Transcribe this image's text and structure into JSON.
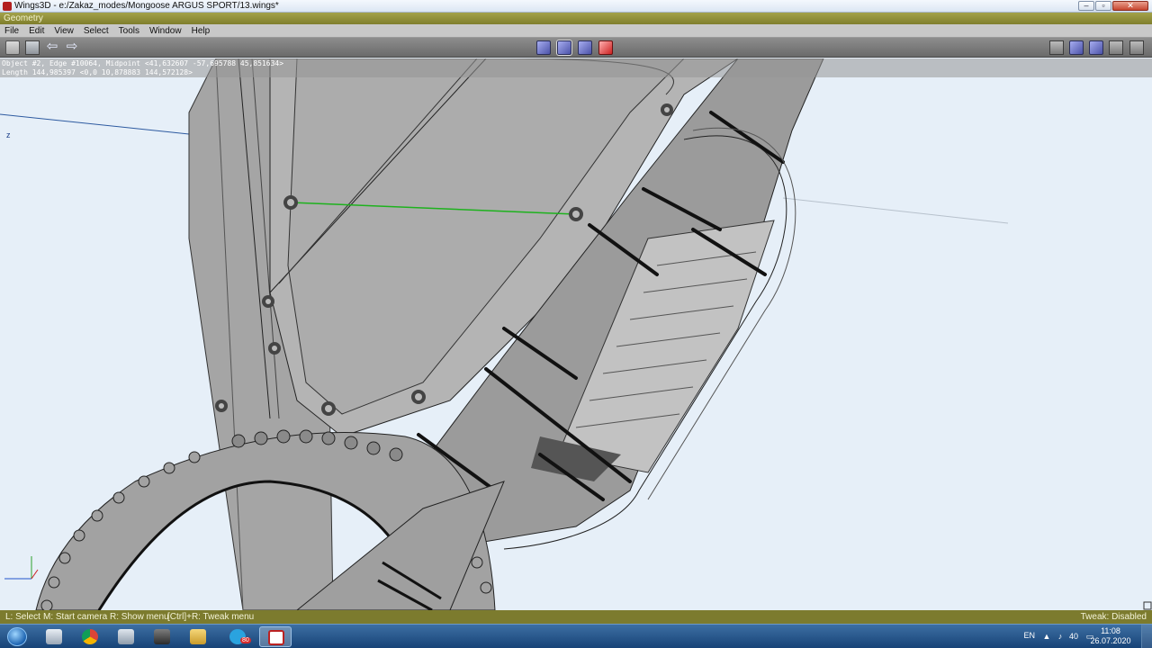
{
  "window": {
    "title": "Wings3D - e:/Zakaz_modes/Mongoose ARGUS SPORT/13.wings*",
    "controls": {
      "minimize": "–",
      "maximize": "▫",
      "close": "✕"
    }
  },
  "geometry_strip": {
    "label": "Geometry"
  },
  "menu": {
    "items": [
      "File",
      "Edit",
      "View",
      "Select",
      "Tools",
      "Window",
      "Help"
    ]
  },
  "toolbar": {
    "left_buttons": [
      "open-folder-icon",
      "save-disk-icon",
      "undo-arrow-icon",
      "redo-arrow-icon"
    ],
    "selection_modes": [
      "vertex-mode",
      "edge-mode",
      "face-mode",
      "body-mode"
    ],
    "right_buttons": [
      "outliner-icon",
      "smooth-shaded-icon",
      "flat-shaded-icon",
      "wireframe-icon",
      "axes-icon"
    ]
  },
  "info": {
    "line1": "Object #2, Edge #10064, Midpoint <41,632607  -57,695788  45,851634>",
    "line2": "Length 144,985397  <0,0  10,878883  144,572128>"
  },
  "viewport": {
    "axis_label": "z",
    "bg_color": "#e6eff8"
  },
  "status": {
    "hints": [
      "L: Select",
      "M: Start camera",
      "R: Show menu",
      "[Ctrl]+R: Tweak menu"
    ],
    "tweak": "Tweak: Disabled"
  },
  "taskbar": {
    "apps": [
      "windows-start",
      "paint-app",
      "chrome-browser",
      "calculator-app",
      "sketchup-app",
      "file-explorer",
      "telegram-app",
      "wings3d-app"
    ],
    "telegram_badge": "80",
    "language": "EN",
    "volume_level": "40",
    "time": "11:08",
    "date": "26.07.2020"
  }
}
